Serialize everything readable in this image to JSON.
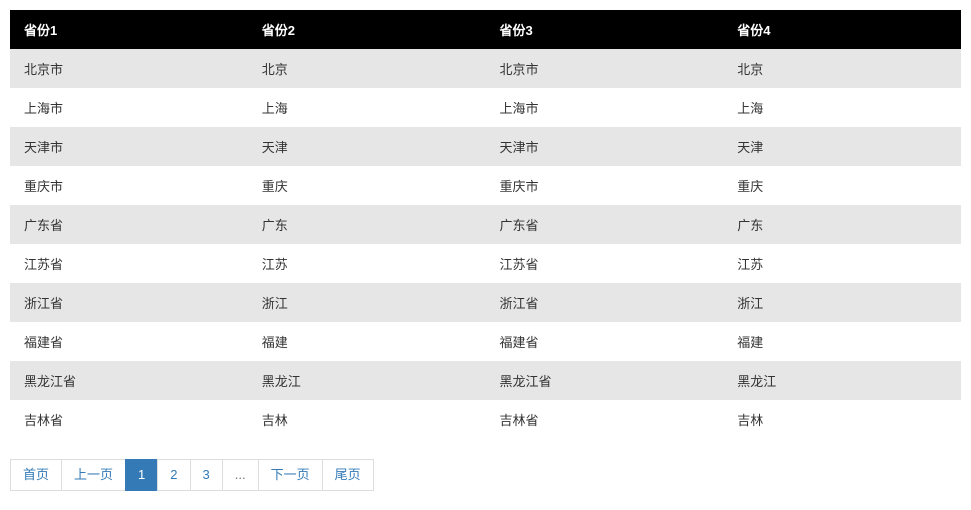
{
  "table": {
    "headers": [
      "省份1",
      "省份2",
      "省份3",
      "省份4"
    ],
    "rows": [
      [
        "北京市",
        "北京",
        "北京市",
        "北京"
      ],
      [
        "上海市",
        "上海",
        "上海市",
        "上海"
      ],
      [
        "天津市",
        "天津",
        "天津市",
        "天津"
      ],
      [
        "重庆市",
        "重庆",
        "重庆市",
        "重庆"
      ],
      [
        "广东省",
        "广东",
        "广东省",
        "广东"
      ],
      [
        "江苏省",
        "江苏",
        "江苏省",
        "江苏"
      ],
      [
        "浙江省",
        "浙江",
        "浙江省",
        "浙江"
      ],
      [
        "福建省",
        "福建",
        "福建省",
        "福建"
      ],
      [
        "黑龙江省",
        "黑龙江",
        "黑龙江省",
        "黑龙江"
      ],
      [
        "吉林省",
        "吉林",
        "吉林省",
        "吉林"
      ]
    ]
  },
  "pagination": {
    "first": "首页",
    "prev": "上一页",
    "pages": [
      "1",
      "2",
      "3"
    ],
    "ellipsis": "...",
    "next": "下一页",
    "last": "尾页",
    "active_index": 0
  }
}
